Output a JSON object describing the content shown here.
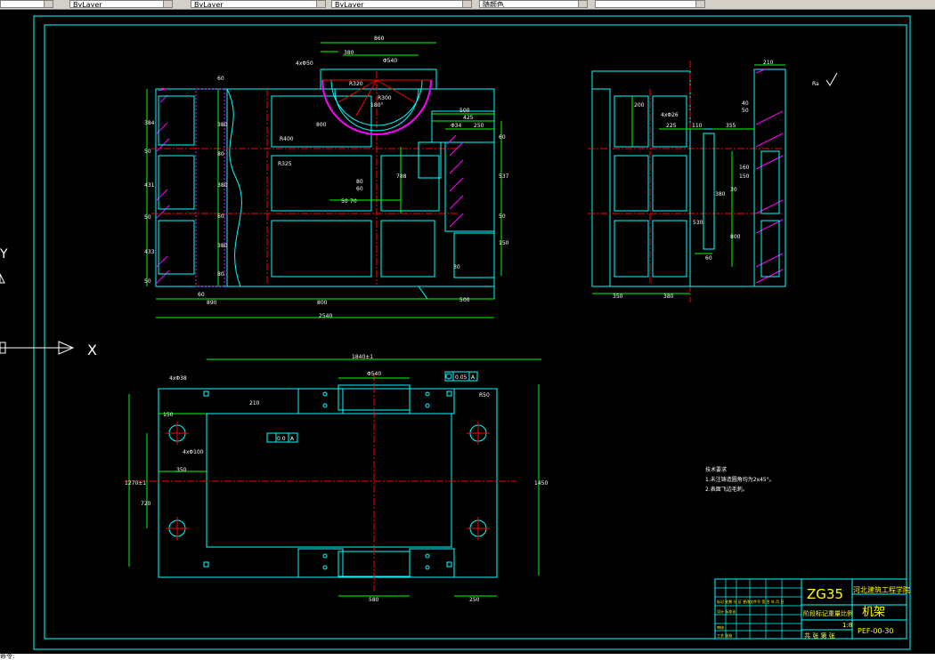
{
  "toolbar": {
    "layer_box_text": "",
    "color_box_text": "ByLayer",
    "linetype_box_text": "ByLayer",
    "lineweight_box_text": "ByLayer",
    "plotstyle_box_text": "随颜色"
  },
  "colors": {
    "frame": "#00ffff",
    "outline": "#00ffff",
    "dimension": "#00ff00",
    "center": "#ff0000",
    "hatch": "#ff00ff",
    "title_text": "#ffff00",
    "background": "#000000"
  },
  "ucs": {
    "x_label": "X",
    "y_label": "Y"
  },
  "front_view": {
    "dims": {
      "top_width": "860",
      "top_inner": "380",
      "bearing_dia": "Φ540",
      "left_hole": "4xΦ50",
      "r_label": "R320",
      "r2_label": "R300",
      "angle": "180°",
      "span_800": "800",
      "r_400": "R400",
      "r_325": "R325",
      "v_80": "80",
      "v_60": "60",
      "v_50": "50",
      "v_70": "70",
      "v_788": "788",
      "right_500": "500",
      "right_425": "425",
      "right_250": "250",
      "right_Φ34": "Φ34",
      "right_60": "60",
      "right_537": "537",
      "right_50b": "50",
      "right_150": "150",
      "right_30": "30",
      "left_384": "384",
      "left_50a": "50",
      "left_431": "431",
      "left_50b": "50",
      "left_433": "433",
      "left_50c": "50",
      "inner_60": "60",
      "inner_380a": "380",
      "inner_80": "80",
      "inner_380b": "380",
      "inner_60b": "60",
      "inner_380c": "380",
      "inner_80b": "80",
      "bottom_60": "60",
      "bottom_890": "890",
      "bottom_800": "800",
      "bottom_500": "500",
      "bottom_2540": "2540"
    }
  },
  "side_view": {
    "dims": {
      "top_210": "210",
      "hole": "4xΦ26",
      "dim_200": "200",
      "dim_225": "225",
      "dim_110": "110",
      "dim_355": "355",
      "dim_40": "40",
      "dim_50": "50",
      "dim_160": "160",
      "dim_150": "150",
      "dim_30": "30",
      "dim_380": "380",
      "dim_800": "800",
      "dim_530": "530",
      "dim_60": "60",
      "bottom_350": "350",
      "bottom_380": "380",
      "roughness": "Ra"
    }
  },
  "plan_view": {
    "dims": {
      "top_total": "1840±1",
      "hole_left": "4xΦ38",
      "bearing": "Φ540",
      "tolerance": "0.05",
      "tolerance_ref": "A",
      "r_label": "R50",
      "w_150": "150",
      "w_210": "210",
      "hole_100": "4xΦ100",
      "flat": "0.0",
      "flat_ref": "A",
      "w_350": "350",
      "left_1270": "1270±1",
      "left_720": "720",
      "right_1450": "1450",
      "bottom_580": "580",
      "bottom_250": "250"
    }
  },
  "notes": {
    "title": "技术要求",
    "line1": "1.未注铸造圆角均为2x45°。",
    "line2": "2.表面飞边毛刺。"
  },
  "title_block": {
    "material": "ZG35",
    "school": "河北建筑工程学院",
    "part_name": "机架",
    "drawing_no": "PEF-00-30",
    "stage_label": "阶段标记",
    "weight_label": "重量",
    "scale_label": "比例",
    "scale_value": "1:8",
    "sheet_label": "共 张 第 张",
    "row1": "标记 处数 分 区 更改文件号 签 名 年.月.日",
    "row2": "设计 标准化",
    "row3": "审核",
    "row4": "工艺 批准"
  },
  "status": {
    "text": "命令: "
  }
}
